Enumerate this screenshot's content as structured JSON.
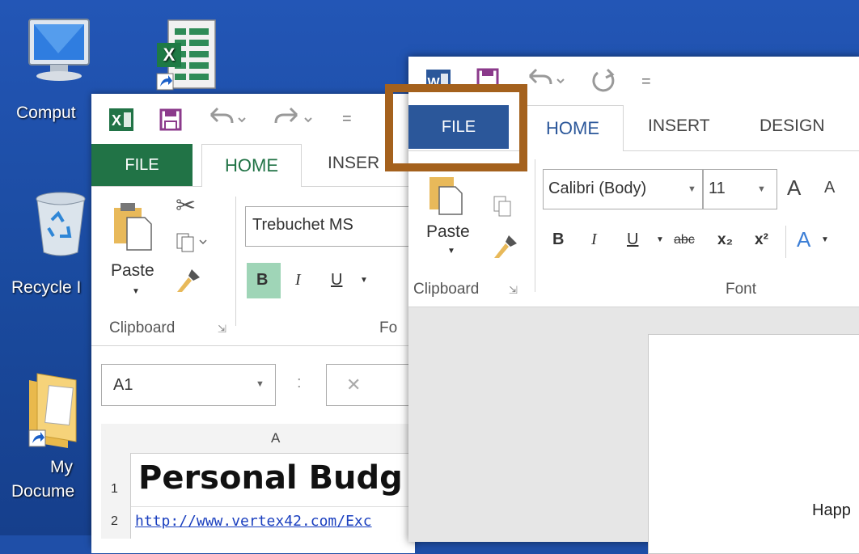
{
  "desktop": {
    "icons": [
      {
        "name": "computer",
        "label": "Comput"
      },
      {
        "name": "excel-shortcut",
        "label": ""
      },
      {
        "name": "recycle-bin",
        "label": "Recycle I"
      },
      {
        "name": "my-documents",
        "label_line1": "My",
        "label_line2": "Docume"
      }
    ]
  },
  "excel": {
    "qat": {
      "app_icon": "excel-logo-icon",
      "save": "save-icon",
      "undo": "undo-icon",
      "redo": "redo-icon",
      "customize": "="
    },
    "tabs": {
      "file": "FILE",
      "home": "HOME",
      "insert": "INSER"
    },
    "clipboard": {
      "paste": "Paste",
      "group_label": "Clipboard"
    },
    "font": {
      "name": "Trebuchet MS",
      "bold": "B",
      "italic": "I",
      "underline": "U",
      "group_label": "Fo"
    },
    "formula_bar": {
      "name_box": "A1",
      "colon": ":",
      "cancel": "✕"
    },
    "grid": {
      "column_header": "A",
      "rows": [
        {
          "num": "1",
          "content": "Personal Budg"
        },
        {
          "num": "2",
          "content": "http://www.vertex42.com/Exc"
        }
      ]
    }
  },
  "word": {
    "qat": {
      "app_icon": "word-logo-icon",
      "save": "save-icon",
      "undo": "undo-icon",
      "redo": "redo-icon",
      "customize": "="
    },
    "tabs": {
      "file": "FILE",
      "home": "HOME",
      "insert": "INSERT",
      "design": "DESIGN"
    },
    "clipboard": {
      "paste": "Paste",
      "group_label": "Clipboard"
    },
    "font": {
      "name": "Calibri (Body)",
      "size": "11",
      "bold": "B",
      "italic": "I",
      "underline": "U",
      "strike": "abc",
      "subscript": "x₂",
      "superscript": "x²",
      "text_effects": "A",
      "grow": "A",
      "shrink": "A",
      "group_label": "Font"
    },
    "document": {
      "text": "Happ"
    }
  },
  "colors": {
    "excel_green": "#217346",
    "word_blue": "#2b579a",
    "highlight": "#a4611d",
    "desktop": "#1f4fa8"
  }
}
